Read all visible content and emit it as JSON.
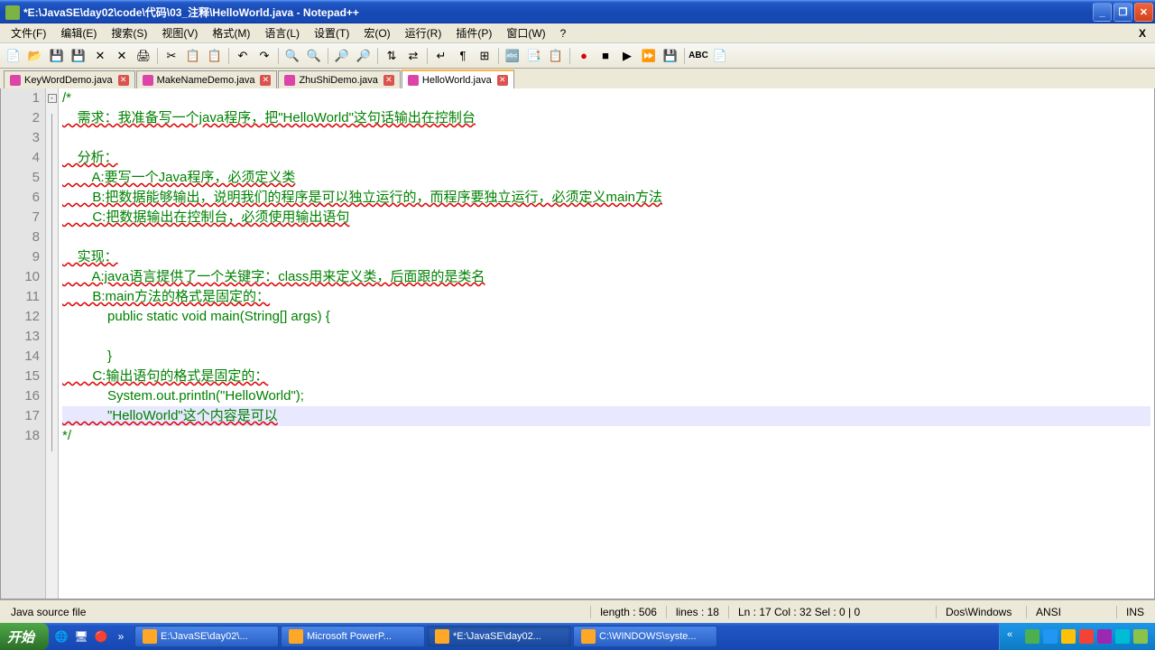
{
  "window": {
    "title": "*E:\\JavaSE\\day02\\code\\代码\\03_注释\\HelloWorld.java - Notepad++"
  },
  "menu": {
    "items": [
      "文件(F)",
      "编辑(E)",
      "搜索(S)",
      "视图(V)",
      "格式(M)",
      "语言(L)",
      "设置(T)",
      "宏(O)",
      "运行(R)",
      "插件(P)",
      "窗口(W)",
      "?"
    ],
    "closeX": "X"
  },
  "tabs": [
    {
      "label": "KeyWordDemo.java",
      "active": false
    },
    {
      "label": "MakeNameDemo.java",
      "active": false
    },
    {
      "label": "ZhuShiDemo.java",
      "active": false
    },
    {
      "label": "HelloWorld.java",
      "active": true
    }
  ],
  "code": {
    "lines": [
      {
        "n": 1,
        "text": "/*",
        "fold": "-"
      },
      {
        "n": 2,
        "text": "    需求：我准备写一个java程序，把\"HelloWorld\"这句话输出在控制台"
      },
      {
        "n": 3,
        "text": ""
      },
      {
        "n": 4,
        "text": "    分析："
      },
      {
        "n": 5,
        "text": "        A:要写一个Java程序，必须定义类"
      },
      {
        "n": 6,
        "text": "        B:把数据能够输出，说明我们的程序是可以独立运行的，而程序要独立运行，必须定义main方法"
      },
      {
        "n": 7,
        "text": "        C:把数据输出在控制台，必须使用输出语句"
      },
      {
        "n": 8,
        "text": ""
      },
      {
        "n": 9,
        "text": "    实现："
      },
      {
        "n": 10,
        "text": "        A:java语言提供了一个关键字：class用来定义类，后面跟的是类名"
      },
      {
        "n": 11,
        "text": "        B:main方法的格式是固定的："
      },
      {
        "n": 12,
        "text": "            public static void main(String[] args) {"
      },
      {
        "n": 13,
        "text": ""
      },
      {
        "n": 14,
        "text": "            }"
      },
      {
        "n": 15,
        "text": "        C:输出语句的格式是固定的："
      },
      {
        "n": 16,
        "text": "            System.out.println(\"HelloWorld\");"
      },
      {
        "n": 17,
        "text": "            \"HelloWorld\"这个内容是可以",
        "hl": true
      },
      {
        "n": 18,
        "text": "*/"
      }
    ]
  },
  "status": {
    "type": "Java source file",
    "length": "length : 506",
    "lines": "lines : 18",
    "pos": "Ln : 17    Col : 32    Sel : 0 | 0",
    "eol": "Dos\\Windows",
    "enc": "ANSI",
    "mode": "INS"
  },
  "taskbar": {
    "start": "开始",
    "tasks": [
      {
        "label": "E:\\JavaSE\\day02\\..."
      },
      {
        "label": "Microsoft PowerP..."
      },
      {
        "label": "*E:\\JavaSE\\day02...",
        "active": true
      },
      {
        "label": "C:\\WINDOWS\\syste..."
      }
    ],
    "time": ""
  }
}
